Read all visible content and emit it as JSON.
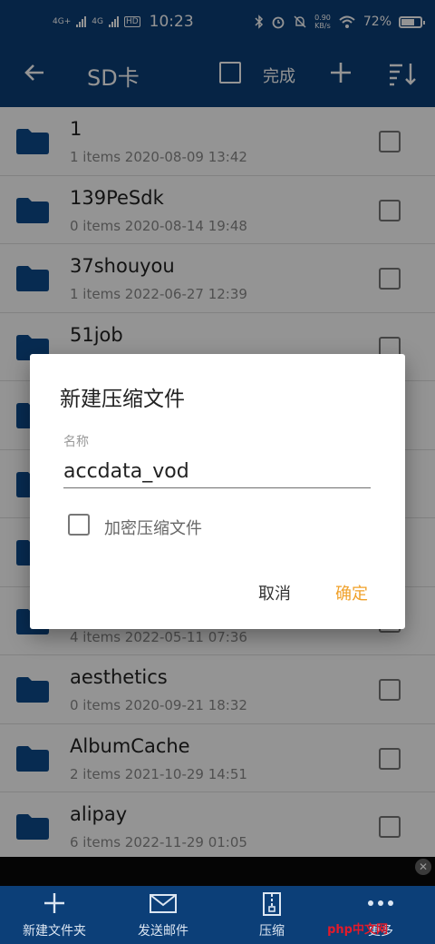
{
  "status_bar": {
    "net1": "4G+",
    "net2": "4G",
    "hd": "HD",
    "time": "10:23",
    "speed_value": "0.90",
    "speed_unit": "KB/s",
    "battery": "72%",
    "battery_level": 0.72
  },
  "app_bar": {
    "title": "SD卡",
    "done_label": "完成"
  },
  "files": [
    {
      "name": "1",
      "meta": "1 items 2020-08-09 13:42"
    },
    {
      "name": "139PeSdk",
      "meta": "0 items 2020-08-14 19:48"
    },
    {
      "name": "37shouyou",
      "meta": "1 items 2022-06-27 12:39"
    },
    {
      "name": "51job",
      "meta": ""
    },
    {
      "name": "",
      "meta": ""
    },
    {
      "name": "",
      "meta": ""
    },
    {
      "name": "",
      "meta": ""
    },
    {
      "name": "",
      "meta": "4 items 2022-05-11 07:36"
    },
    {
      "name": "aesthetics",
      "meta": "0 items 2020-09-21 18:32"
    },
    {
      "name": "AlbumCache",
      "meta": "2 items 2021-10-29 14:51"
    },
    {
      "name": "alipay",
      "meta": "6 items 2022-11-29 01:05"
    }
  ],
  "dialog": {
    "title": "新建压缩文件",
    "field_label": "名称",
    "field_value": "accdata_vod",
    "encrypt_label": "加密压缩文件",
    "cancel_label": "取消",
    "ok_label": "确定"
  },
  "bottom_bar": {
    "new_folder": "新建文件夹",
    "send_mail": "发送邮件",
    "compress": "压缩",
    "more": "更多"
  },
  "watermark": "php中文网",
  "ad_close": "✕",
  "colors": {
    "primary": "#0c3f78",
    "accent": "#f0a12a",
    "folder": "#0d4a8c"
  }
}
